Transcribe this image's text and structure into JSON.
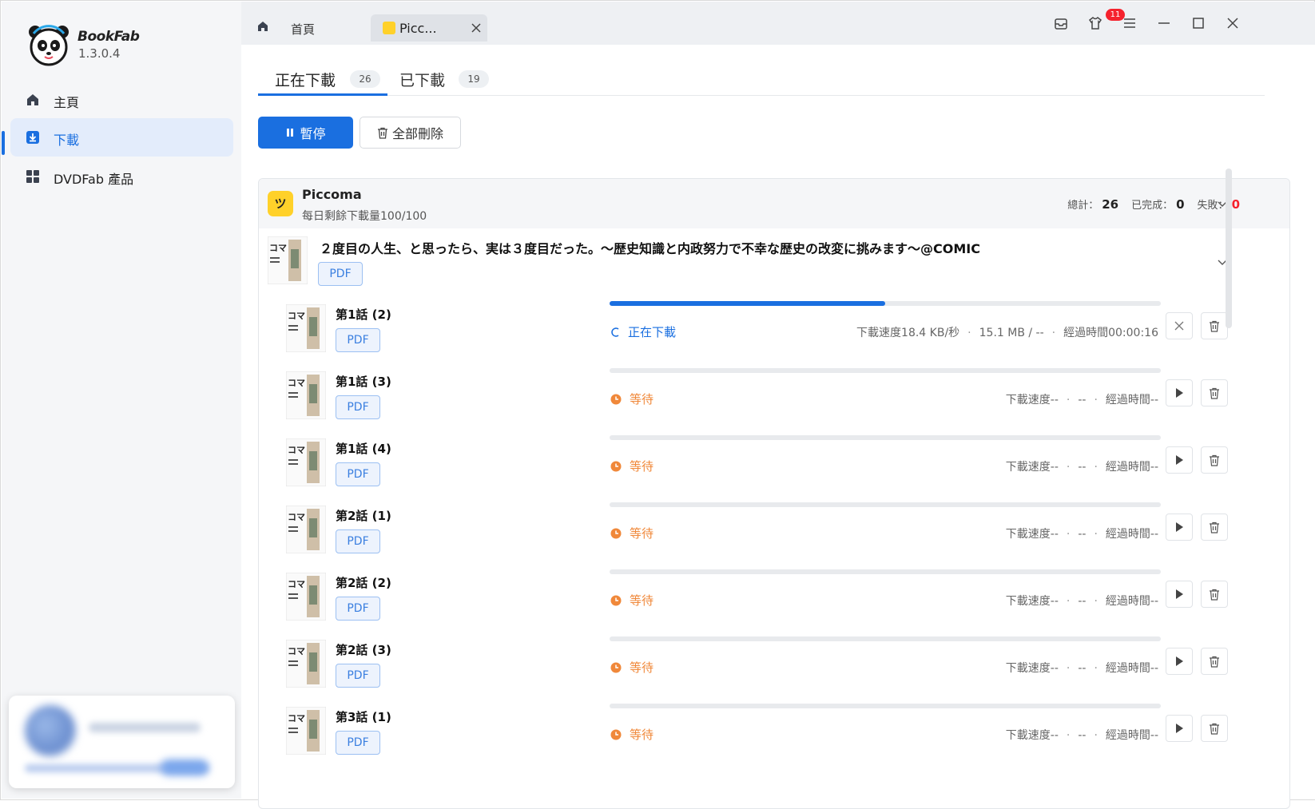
{
  "app": {
    "name": "BookFab",
    "version": "1.3.0.4"
  },
  "sidebar": {
    "items": [
      {
        "label": "主頁",
        "icon": "home-icon"
      },
      {
        "label": "下載",
        "icon": "download-icon",
        "active": true
      },
      {
        "label": "DVDFab 產品",
        "icon": "grid-icon"
      }
    ]
  },
  "titlebar": {
    "home_label": "首頁",
    "tab_label": "Picc...",
    "notification_count": "11"
  },
  "download_tabs": [
    {
      "label": "正在下載",
      "count": "26",
      "active": true
    },
    {
      "label": "已下載",
      "count": "19"
    }
  ],
  "toolbar": {
    "pause_label": "暫停",
    "delete_all_label": "全部刪除"
  },
  "source": {
    "name": "Piccoma",
    "logo_glyph": "ツ",
    "quota": "每日剩餘下載量100/100",
    "total_label": "總計：",
    "total_value": "26",
    "done_label": "已完成：",
    "done_value": "0",
    "failed_label": "失敗：",
    "failed_value": "0"
  },
  "series": {
    "title": "２度目の人生、と思ったら、実は３度目だった。～歴史知識と内政努力で不幸な歴史の改変に挑みます～@COMIC",
    "format": "PDF"
  },
  "episodes": [
    {
      "title": "第1話 (2)",
      "format": "PDF",
      "status": "正在下載",
      "state": "downloading",
      "progress": 0.5,
      "speed": "下載速度18.4 KB/秒",
      "size": "15.1 MB / --",
      "elapsed": "經過時間00:00:16"
    },
    {
      "title": "第1話 (3)",
      "format": "PDF",
      "status": "等待",
      "state": "waiting",
      "progress": 0,
      "speed": "下載速度--",
      "size": "--",
      "elapsed": "經過時間--"
    },
    {
      "title": "第1話 (4)",
      "format": "PDF",
      "status": "等待",
      "state": "waiting",
      "progress": 0,
      "speed": "下載速度--",
      "size": "--",
      "elapsed": "經過時間--"
    },
    {
      "title": "第2話 (1)",
      "format": "PDF",
      "status": "等待",
      "state": "waiting",
      "progress": 0,
      "speed": "下載速度--",
      "size": "--",
      "elapsed": "經過時間--"
    },
    {
      "title": "第2話 (2)",
      "format": "PDF",
      "status": "等待",
      "state": "waiting",
      "progress": 0,
      "speed": "下載速度--",
      "size": "--",
      "elapsed": "經過時間--"
    },
    {
      "title": "第2話 (3)",
      "format": "PDF",
      "status": "等待",
      "state": "waiting",
      "progress": 0,
      "speed": "下載速度--",
      "size": "--",
      "elapsed": "經過時間--"
    },
    {
      "title": "第3話 (1)",
      "format": "PDF",
      "status": "等待",
      "state": "waiting",
      "progress": 0,
      "speed": "下載速度--",
      "size": "--",
      "elapsed": "經過時間--"
    }
  ],
  "colors": {
    "accent": "#1a6fe0",
    "waiting": "#f0883a",
    "danger": "#f5222d",
    "piccoma": "#ffd12a"
  }
}
